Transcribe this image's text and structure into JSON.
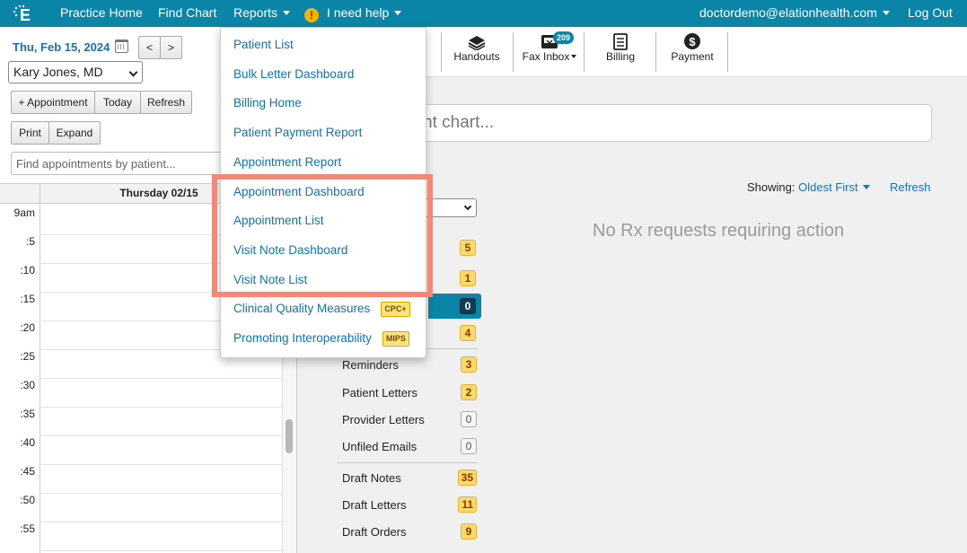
{
  "topnav": {
    "practice_home": "Practice Home",
    "find_chart": "Find Chart",
    "reports": "Reports",
    "help": "I need help",
    "help_icon": "!",
    "user_email": "doctordemo@elationhealth.com",
    "logout": "Log Out",
    "logo_icon": "elation-logo-icon"
  },
  "schedule": {
    "date": "Thu, Feb 15, 2024",
    "prev": "<",
    "next": ">",
    "provider": "Kary Jones, MD",
    "add_appointment": "+ Appointment",
    "today": "Today",
    "refresh": "Refresh",
    "print": "Print",
    "expand": "Expand",
    "find_placeholder": "Find appointments by patient...",
    "day_title": "Thursday 02/15",
    "times": [
      "9am",
      ":5",
      ":10",
      ":15",
      ":20",
      ":25",
      ":30",
      ":35",
      ":40",
      ":45",
      ":50",
      ":55"
    ]
  },
  "toolbar": {
    "handouts": "Handouts",
    "fax_inbox": "Fax Inbox",
    "fax_count": "209",
    "billing": "Billing",
    "payment": "Payment"
  },
  "main": {
    "search_partial": "nt chart...",
    "showing_label": "Showing:",
    "showing_value": "Oldest First",
    "refresh": "Refresh",
    "empty_message": "No Rx requests requiring action"
  },
  "inbox": {
    "partial_badges": [
      "5",
      "1",
      "0",
      "4"
    ],
    "items": [
      {
        "label": "Reminders",
        "count": "3"
      },
      {
        "label": "Patient Letters",
        "count": "2"
      },
      {
        "label": "Provider Letters",
        "count": "0"
      },
      {
        "label": "Unfiled Emails",
        "count": "0"
      },
      {
        "label": "Draft Notes",
        "count": "35"
      },
      {
        "label": "Draft Letters",
        "count": "11"
      },
      {
        "label": "Draft Orders",
        "count": "9"
      }
    ]
  },
  "reports_menu": {
    "items": [
      {
        "label": "Patient List"
      },
      {
        "label": "Bulk Letter Dashboard"
      },
      {
        "label": "Billing Home"
      },
      {
        "label": "Patient Payment Report"
      },
      {
        "label": "Appointment Report"
      },
      {
        "label": "Appointment Dashboard"
      },
      {
        "label": "Appointment List"
      },
      {
        "label": "Visit Note Dashboard"
      },
      {
        "label": "Visit Note List"
      },
      {
        "label": "Clinical Quality Measures",
        "tag": "CPC+"
      },
      {
        "label": "Promoting Interoperability",
        "tag": "MIPS"
      }
    ]
  },
  "colors": {
    "brand": "#0a85a8",
    "link": "#0f75b0",
    "highlight": "#f48875",
    "badge_yellow": "#fbd96a"
  }
}
